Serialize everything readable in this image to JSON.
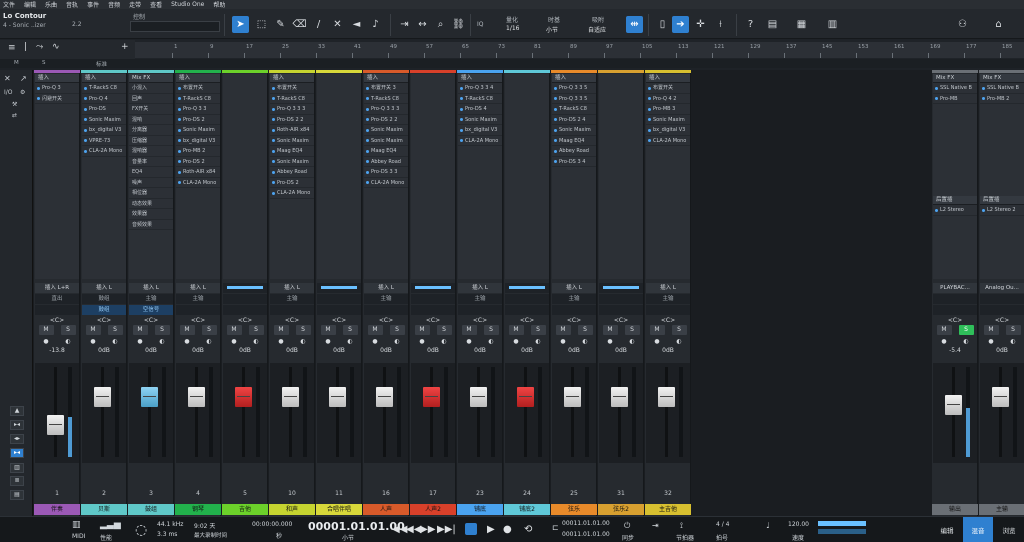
{
  "menu": [
    "文件",
    "编辑",
    "乐曲",
    "音轨",
    "事件",
    "音频",
    "走带",
    "查看",
    "Studio One",
    "帮助"
  ],
  "song": {
    "title": "Lo Contour",
    "subtitle": "4 - Sonic ..izer",
    "version": "2.2"
  },
  "toolbar": {
    "control_label": "控制",
    "quantize_label": "量化",
    "quantize_value": "1/16",
    "timebase_label": "时基",
    "timebase_value": "小节",
    "snap_label": "吸附",
    "snap_value": "自适应",
    "help": "?",
    "iq_label": "IQ"
  },
  "ruler": {
    "ticks": [
      "1",
      "9",
      "17",
      "25",
      "33",
      "41",
      "49",
      "57",
      "65",
      "73",
      "81",
      "89",
      "97",
      "105",
      "113",
      "121",
      "129",
      "137",
      "145",
      "153",
      "161",
      "169",
      "177",
      "185",
      "193"
    ],
    "marker_label": "标准",
    "m_label": "M",
    "s_label": "S"
  },
  "left_panel": {
    "io_label": "I/O",
    "icons": [
      "close-icon",
      "pin-icon",
      "wrench-icon",
      "routing-icon"
    ]
  },
  "strips": [
    {
      "name": "伴奏",
      "color": "#9b59b6",
      "num": "1",
      "insert_head": "插入",
      "inserts": [
        "Pro-Q 3",
        "闪避开关"
      ],
      "io": "插入 L+R",
      "route": "直出",
      "volume": "-13.8",
      "fader": "white",
      "fader_level": 0.32,
      "meter": 0.45,
      "vol_top": "",
      "solo": false
    },
    {
      "name": "贝斯",
      "color": "#5fc8c8",
      "num": "2",
      "insert_head": "插入",
      "inserts": [
        "T-RackS C8",
        "Pro-Q 4",
        "Pro-DS",
        "Sonic Maxim",
        "bx_digital V3",
        "VPRE-73",
        "CLA-2A Mono"
      ],
      "io": "插入 L",
      "route": "鼓组",
      "sub": "鼓组",
      "volume": "0dB",
      "fader": "white",
      "fader_level": 0.72,
      "meter": 0.0,
      "vol_top": "",
      "solo": false
    },
    {
      "name": "鼓组",
      "color": "#5fc8c8",
      "num": "3",
      "insert_head": "Mix FX",
      "inserts": [
        "小混入",
        "回声",
        "FX开关",
        "混响",
        "分离器",
        "压缩器",
        "混响器",
        "音量率",
        "EQ4",
        "噪声",
        "相位器",
        "动态效果",
        "效果器",
        "音频效果"
      ],
      "plain": true,
      "io": "插入 L",
      "route": "主输",
      "sub": "空信号",
      "volume": "0dB",
      "fader": "blue",
      "fader_level": 0.72,
      "meter": 0.0,
      "vol_top": "",
      "solo": false
    },
    {
      "name": "钢琴",
      "color": "#22b14c",
      "num": "4",
      "insert_head": "插入",
      "inserts": [
        "布置开关",
        "T-RackS C8",
        "Pro-Q 3 3",
        "Pro-DS 2",
        "Sonic Maxim",
        "bx_digital V3",
        "Pro-MB 2",
        "Pro-DS 2",
        "Roth-AIR x84",
        "CLA-2A Mono"
      ],
      "io": "插入 L",
      "route": "主输",
      "sub": "",
      "volume": "0dB",
      "fader": "white",
      "fader_level": 0.72,
      "meter": 0.0,
      "vol_top": "",
      "solo": false
    },
    {
      "name": "吉他",
      "color": "#6cd12a",
      "num": "5",
      "insert_head": "",
      "inserts": [],
      "io": "",
      "route": "",
      "sub": "",
      "volume": "0dB",
      "fader": "red",
      "fader_level": 0.72,
      "meter": 0.0,
      "vol_top": "",
      "solo": false
    },
    {
      "name": "和声",
      "color": "#c6d430",
      "num": "10",
      "insert_head": "插入",
      "inserts": [
        "布置开关",
        "T-RackS C8",
        "Pro-Q 3 3 3",
        "Pro-DS 2 2",
        "Roth-AIR x84",
        "Sonic Maxim",
        "Maag EQ4",
        "Sonic Maxim",
        "Abbey Road",
        "Pro-DS 2",
        "CLA-2A Mono"
      ],
      "io": "插入 L",
      "route": "主输",
      "sub": "",
      "volume": "0dB",
      "fader": "white",
      "fader_level": 0.72,
      "meter": 0.0,
      "vol_top": "",
      "solo": false
    },
    {
      "name": "合唱伴唱",
      "color": "#d8d83a",
      "num": "11",
      "insert_head": "",
      "inserts": [],
      "io": "",
      "route": "",
      "sub": "",
      "volume": "0dB",
      "fader": "white",
      "fader_level": 0.72,
      "meter": 0.0,
      "vol_top": "",
      "solo": false
    },
    {
      "name": "人声",
      "color": "#d85a2a",
      "num": "16",
      "insert_head": "插入",
      "inserts": [
        "布置开关 3",
        "T-RackS C8",
        "Pro-Q 3 3 3",
        "Pro-DS 2 2",
        "Sonic Maxim",
        "Sonic Maxim",
        "Maag EQ4",
        "Abbey Road",
        "Pro-DS 3 3",
        "CLA-2A Mono"
      ],
      "io": "插入 L",
      "route": "主输",
      "sub": "",
      "volume": "0dB",
      "fader": "white",
      "fader_level": 0.72,
      "meter": 0.0,
      "vol_top": "",
      "solo": false
    },
    {
      "name": "人声2",
      "color": "#d8402a",
      "num": "17",
      "insert_head": "",
      "inserts": [],
      "io": "",
      "route": "",
      "sub": "",
      "volume": "0dB",
      "fader": "red",
      "fader_level": 0.72,
      "meter": 0.0,
      "vol_top": "",
      "solo": false
    },
    {
      "name": "铺底",
      "color": "#4aa3f0",
      "num": "23",
      "insert_head": "插入",
      "inserts": [
        "Pro-Q 3 3 4",
        "T-RackS C8",
        "Pro-DS 4",
        "Sonic Maxim",
        "bx_digital V3",
        "CLA-2A Mono"
      ],
      "io": "插入 L",
      "route": "主输",
      "sub": "",
      "volume": "0dB",
      "fader": "white",
      "fader_level": 0.72,
      "meter": 0.0,
      "vol_top": "",
      "solo": false
    },
    {
      "name": "铺底2",
      "color": "#5fc8d8",
      "num": "24",
      "insert_head": "",
      "inserts": [],
      "io": "",
      "route": "",
      "sub": "",
      "volume": "0dB",
      "fader": "red",
      "fader_level": 0.72,
      "meter": 0.0,
      "vol_top": "",
      "solo": false
    },
    {
      "name": "弦乐",
      "color": "#e88a2a",
      "num": "25",
      "insert_head": "插入",
      "inserts": [
        "Pro-Q 3 3 5",
        "Pro-Q 3 3 5",
        "T-RackS C8",
        "Pro-DS 2 4",
        "Sonic Maxim",
        "Maag EQ4",
        "Abbey Road",
        "Pro-DS 3 4"
      ],
      "io": "插入 L",
      "route": "主输",
      "sub": "",
      "volume": "0dB",
      "fader": "white",
      "fader_level": 0.72,
      "meter": 0.0,
      "vol_top": "",
      "solo": false
    },
    {
      "name": "弦乐2",
      "color": "#d8a030",
      "num": "31",
      "insert_head": "",
      "inserts": [],
      "io": "",
      "route": "",
      "sub": "",
      "volume": "0dB",
      "fader": "white",
      "fader_level": 0.72,
      "meter": 0.0,
      "vol_top": "",
      "solo": false
    },
    {
      "name": "主吉他",
      "color": "#d8c030",
      "num": "32",
      "insert_head": "插入",
      "inserts": [
        "布置开关",
        "Pro-Q 4 2",
        "Pro-MB 3",
        "Sonic Maxim",
        "bx_digital V3",
        "CLA-2A Mono"
      ],
      "io": "插入 L",
      "route": "主输",
      "sub": "",
      "volume": "0dB",
      "fader": "white",
      "fader_level": 0.72,
      "meter": 0.0,
      "vol_top": "",
      "solo": false
    }
  ],
  "bus_strips": [
    {
      "name": "输出",
      "color": "#6a6f75",
      "insert_head": "Mix FX",
      "inserts": [
        "SSL Native B",
        "Pro-MB"
      ],
      "post_head": "后置插",
      "post": [
        "L2 Stereo"
      ],
      "io": "PLAYBAC...",
      "volume": "-5.4",
      "fader_level": 0.6,
      "meter": 0.55,
      "solo": true
    },
    {
      "name": "主输",
      "color": "#6a6f75",
      "insert_head": "Mix FX",
      "inserts": [
        "SSL Native B",
        "Pro-MB 2"
      ],
      "post_head": "后置插",
      "post": [
        "L2 Stereo 2"
      ],
      "io": "Analog Ou...",
      "volume": "0dB",
      "fader_level": 0.72,
      "meter": 0.0,
      "solo": false
    }
  ],
  "transport": {
    "midi_label": "MIDI",
    "perf_label": "性能",
    "sample_rate": "44.1 kHz",
    "latency": "3.3 ms",
    "time_val": "9:02 天",
    "time_label": "最大录制时间",
    "secondary_pos": "00:00:00.000",
    "secondary_unit": "秒",
    "primary_pos": "00001.01.01.00",
    "primary_unit": "小节",
    "loop_start": "00011.01.01.00",
    "loop_end": "00011.01.01.00",
    "sync_label": "同步",
    "metronome_label": "节拍器",
    "signature": "4 / 4",
    "sig_label": "拍号",
    "tempo": "120.00",
    "tempo_label": "速度",
    "tab_edit": "编辑",
    "tab_mix": "混音",
    "tab_browse": "浏览"
  }
}
